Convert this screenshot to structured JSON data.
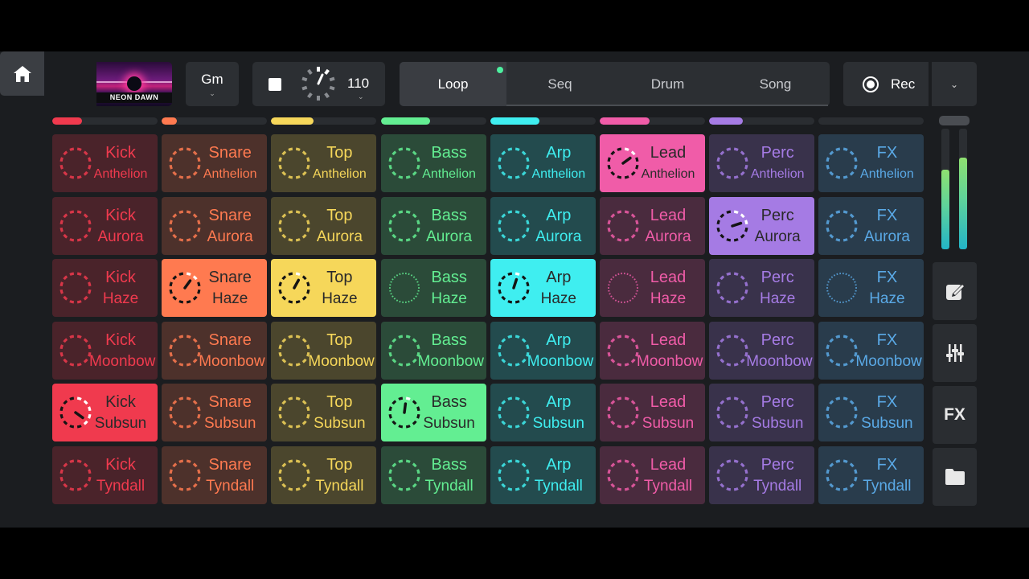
{
  "header": {
    "home_icon": "home-icon",
    "album": {
      "title": "NEON DAWN"
    },
    "key": {
      "label": "Gm"
    },
    "transport": {
      "bpm": "110"
    },
    "tabs": [
      {
        "label": "Loop",
        "active": true
      },
      {
        "label": "Seq",
        "active": false
      },
      {
        "label": "Drum",
        "active": false
      },
      {
        "label": "Song",
        "active": false
      }
    ],
    "rec": {
      "label": "Rec"
    }
  },
  "colors": {
    "kick": "#f03a4e",
    "snare": "#ff7a50",
    "top": "#f6d75a",
    "bass": "#63ee92",
    "arp": "#3feef0",
    "lead": "#f05ca8",
    "perc": "#a57be4",
    "fx": "#5aa9e6",
    "accent_green": "#4df0a0"
  },
  "column_progress": [
    0.28,
    0.14,
    0.4,
    0.47,
    0.47,
    0.47,
    0.32,
    0
  ],
  "grid": {
    "columns": [
      "Kick",
      "Snare",
      "Top",
      "Bass",
      "Arp",
      "Lead",
      "Perc",
      "FX"
    ],
    "rows": [
      {
        "name": "Anthelion",
        "pads": [
          {
            "label": "Kick",
            "sub": "Anthelion",
            "active": false
          },
          {
            "label": "Snare",
            "sub": "Anthelion",
            "active": false
          },
          {
            "label": "Top",
            "sub": "Anthelion",
            "active": false
          },
          {
            "label": "Bass",
            "sub": "Anthelion",
            "active": false
          },
          {
            "label": "Arp",
            "sub": "Anthelion",
            "active": false
          },
          {
            "label": "Lead",
            "sub": "Anthelion",
            "active": true,
            "progress": 0.15
          },
          {
            "label": "Perc",
            "sub": "Anthelion",
            "active": false
          },
          {
            "label": "FX",
            "sub": "Anthelion",
            "active": false
          }
        ]
      },
      {
        "name": "Aurora",
        "pads": [
          {
            "label": "Kick",
            "sub": "Aurora",
            "active": false
          },
          {
            "label": "Snare",
            "sub": "Aurora",
            "active": false
          },
          {
            "label": "Top",
            "sub": "Aurora",
            "active": false
          },
          {
            "label": "Bass",
            "sub": "Aurora",
            "active": false
          },
          {
            "label": "Arp",
            "sub": "Aurora",
            "active": false
          },
          {
            "label": "Lead",
            "sub": "Aurora",
            "active": false
          },
          {
            "label": "Perc",
            "sub": "Aurora",
            "active": true,
            "progress": 0.2
          },
          {
            "label": "FX",
            "sub": "Aurora",
            "active": false
          }
        ]
      },
      {
        "name": "Haze",
        "pads": [
          {
            "label": "Kick",
            "sub": "Haze",
            "active": false
          },
          {
            "label": "Snare",
            "sub": "Haze",
            "active": true,
            "progress": 0.1
          },
          {
            "label": "Top",
            "sub": "Haze",
            "active": true,
            "progress": 0.08
          },
          {
            "label": "Bass",
            "sub": "Haze",
            "active": false,
            "fine": true
          },
          {
            "label": "Arp",
            "sub": "Haze",
            "active": true,
            "progress": 0.05
          },
          {
            "label": "Lead",
            "sub": "Haze",
            "active": false,
            "fine": true
          },
          {
            "label": "Perc",
            "sub": "Haze",
            "active": false
          },
          {
            "label": "FX",
            "sub": "Haze",
            "active": false,
            "fine": true
          }
        ]
      },
      {
        "name": "Moonbow",
        "pads": [
          {
            "label": "Kick",
            "sub": "Moonbow",
            "active": false
          },
          {
            "label": "Snare",
            "sub": "Moonbow",
            "active": false
          },
          {
            "label": "Top",
            "sub": "Moonbow",
            "active": false
          },
          {
            "label": "Bass",
            "sub": "Moonbow",
            "active": false
          },
          {
            "label": "Arp",
            "sub": "Moonbow",
            "active": false
          },
          {
            "label": "Lead",
            "sub": "Moonbow",
            "active": false
          },
          {
            "label": "Perc",
            "sub": "Moonbow",
            "active": false
          },
          {
            "label": "FX",
            "sub": "Moonbow",
            "active": false
          }
        ]
      },
      {
        "name": "Subsun",
        "pads": [
          {
            "label": "Kick",
            "sub": "Subsun",
            "active": true,
            "progress": 0.35
          },
          {
            "label": "Snare",
            "sub": "Subsun",
            "active": false
          },
          {
            "label": "Top",
            "sub": "Subsun",
            "active": false
          },
          {
            "label": "Bass",
            "sub": "Subsun",
            "active": true,
            "progress": 0.02
          },
          {
            "label": "Arp",
            "sub": "Subsun",
            "active": false
          },
          {
            "label": "Lead",
            "sub": "Subsun",
            "active": false
          },
          {
            "label": "Perc",
            "sub": "Subsun",
            "active": false
          },
          {
            "label": "FX",
            "sub": "Subsun",
            "active": false
          }
        ]
      },
      {
        "name": "Tyndall",
        "pads": [
          {
            "label": "Kick",
            "sub": "Tyndall",
            "active": false
          },
          {
            "label": "Snare",
            "sub": "Tyndall",
            "active": false
          },
          {
            "label": "Top",
            "sub": "Tyndall",
            "active": false
          },
          {
            "label": "Bass",
            "sub": "Tyndall",
            "active": false
          },
          {
            "label": "Arp",
            "sub": "Tyndall",
            "active": false
          },
          {
            "label": "Lead",
            "sub": "Tyndall",
            "active": false
          },
          {
            "label": "Perc",
            "sub": "Tyndall",
            "active": false
          },
          {
            "label": "FX",
            "sub": "Tyndall",
            "active": false
          }
        ]
      }
    ]
  },
  "sidebar": {
    "meters": [
      0.66,
      0.76
    ],
    "buttons": [
      {
        "icon": "edit-icon"
      },
      {
        "icon": "mixer-icon"
      },
      {
        "label": "FX"
      },
      {
        "icon": "folder-icon"
      }
    ]
  }
}
